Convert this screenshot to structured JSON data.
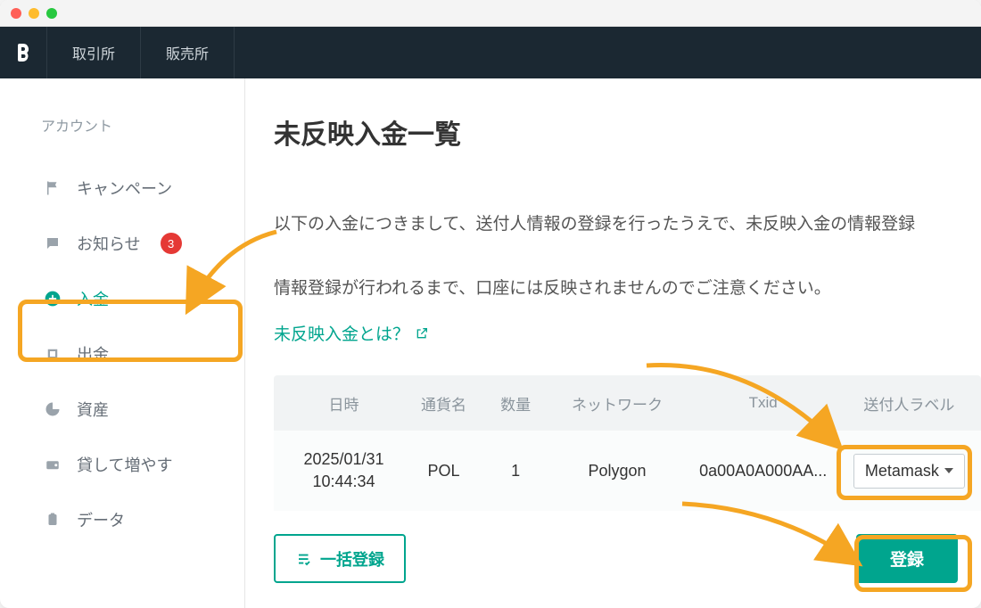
{
  "topnav": {
    "items": [
      "取引所",
      "販売所"
    ]
  },
  "sidebar": {
    "heading": "アカウント",
    "items": [
      {
        "label": "キャンペーン",
        "icon": "flag"
      },
      {
        "label": "お知らせ",
        "icon": "message",
        "badge": "3"
      },
      {
        "label": "入金",
        "icon": "plus-circle",
        "active": true
      },
      {
        "label": "出金",
        "icon": "export"
      },
      {
        "label": "資産",
        "icon": "pie"
      },
      {
        "label": "貸して増やす",
        "icon": "wallet"
      },
      {
        "label": "データ",
        "icon": "clipboard"
      }
    ]
  },
  "main": {
    "title": "未反映入金一覧",
    "desc_line1": "以下の入金につきまして、送付人情報の登録を行ったうえで、未反映入金の情報登録",
    "desc_line2": "情報登録が行われるまで、口座には反映されませんのでご注意ください。",
    "help_link": "未反映入金とは？"
  },
  "table": {
    "headers": {
      "datetime": "日時",
      "currency": "通貨名",
      "amount": "数量",
      "network": "ネットワーク",
      "txid": "Txid",
      "label": "送付人ラベル"
    },
    "rows": [
      {
        "datetime_line1": "2025/01/31",
        "datetime_line2": "10:44:34",
        "currency": "POL",
        "amount": "1",
        "network": "Polygon",
        "txid": "0a00A0A000AA...",
        "label": "Metamask"
      }
    ]
  },
  "actions": {
    "bulk": "一括登録",
    "register": "登録"
  }
}
